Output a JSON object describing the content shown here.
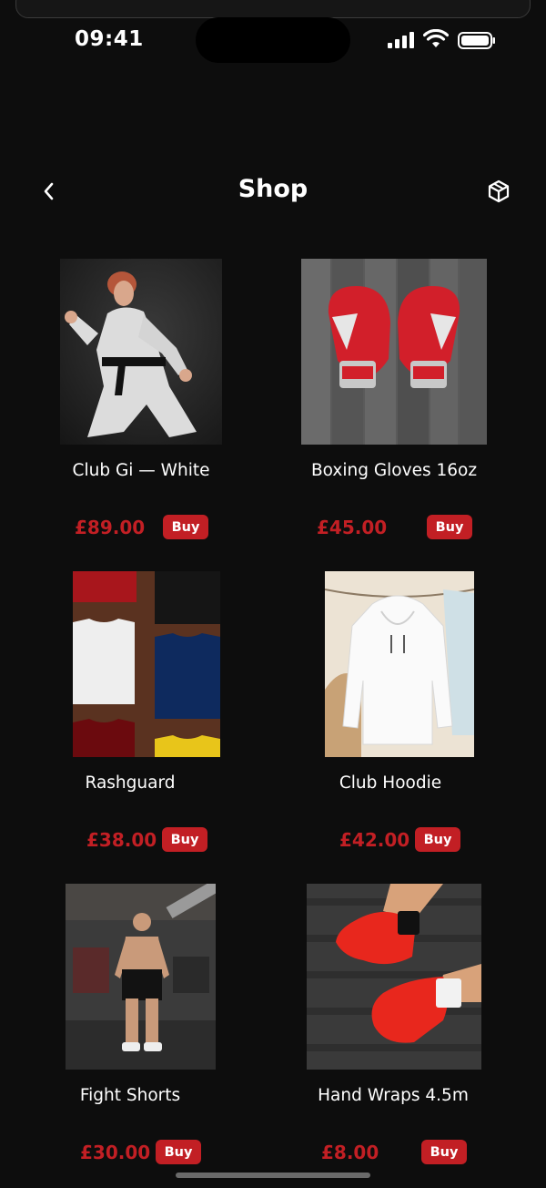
{
  "status_bar": {
    "time": "09:41"
  },
  "nav": {
    "title": "Shop"
  },
  "colors": {
    "accent": "#c21f24",
    "background": "#0d0d0d",
    "text": "#ffffff"
  },
  "products": [
    {
      "name": "Club Gi — White",
      "price": "£89.00",
      "buy_label": "Buy",
      "image": "karate-gi-photo"
    },
    {
      "name": "Boxing Gloves 16oz",
      "price": "£45.00",
      "buy_label": "Buy",
      "image": "boxing-gloves-photo"
    },
    {
      "name": "Rashguard",
      "price": "£38.00",
      "buy_label": "Buy",
      "image": "folded-shirts-photo"
    },
    {
      "name": "Club Hoodie",
      "price": "£42.00",
      "buy_label": "Buy",
      "image": "white-hoodie-photo"
    },
    {
      "name": "Fight Shorts",
      "price": "£30.00",
      "buy_label": "Buy",
      "image": "gym-athlete-photo"
    },
    {
      "name": "Hand Wraps 4.5m",
      "price": "£8.00",
      "buy_label": "Buy",
      "image": "hand-wraps-photo"
    }
  ]
}
